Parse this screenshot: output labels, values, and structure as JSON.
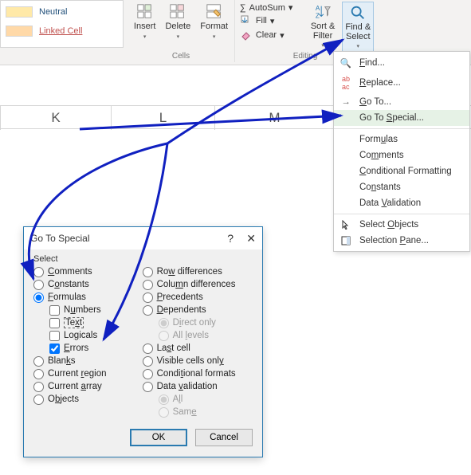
{
  "styles": {
    "neutral": "Neutral",
    "linked": "Linked Cell"
  },
  "ribbon": {
    "cells": {
      "insert": "Insert",
      "delete": "Delete",
      "format": "Format",
      "caption": "Cells"
    },
    "editing": {
      "autosum": "AutoSum",
      "fill": "Fill",
      "clear": "Clear",
      "sort": "Sort &",
      "filter": "Filter",
      "find": "Find &",
      "select": "Select",
      "caption": "Editing"
    }
  },
  "columns": {
    "k": "K",
    "l": "L",
    "m": "M"
  },
  "menu": {
    "find": "Find...",
    "replace": "Replace...",
    "goto": "Go To...",
    "gotospecial": "Go To Special...",
    "formulas": "Formulas",
    "comments": "Comments",
    "cond": "Conditional Formatting",
    "constants": "Constants",
    "datavalid": "Data Validation",
    "selectobj": "Select Objects",
    "selpane": "Selection Pane..."
  },
  "dialog": {
    "title": "Go To Special",
    "section": "Select",
    "left": {
      "comments": "Comments",
      "constants": "Constants",
      "formulas": "Formulas",
      "numbers": "Numbers",
      "text": "Text",
      "logicals": "Logicals",
      "errors": "Errors",
      "blanks": "Blanks",
      "curregion": "Current region",
      "curarray": "Current array",
      "objects": "Objects"
    },
    "right": {
      "rowdiff": "Row differences",
      "coldiff": "Column differences",
      "precedents": "Precedents",
      "dependents": "Dependents",
      "directonly": "Direct only",
      "alllevels": "All levels",
      "lastcell": "Last cell",
      "visible": "Visible cells only",
      "condfmt": "Conditional formats",
      "datavalid": "Data validation",
      "all": "All",
      "same": "Same"
    },
    "ok": "OK",
    "cancel": "Cancel"
  }
}
